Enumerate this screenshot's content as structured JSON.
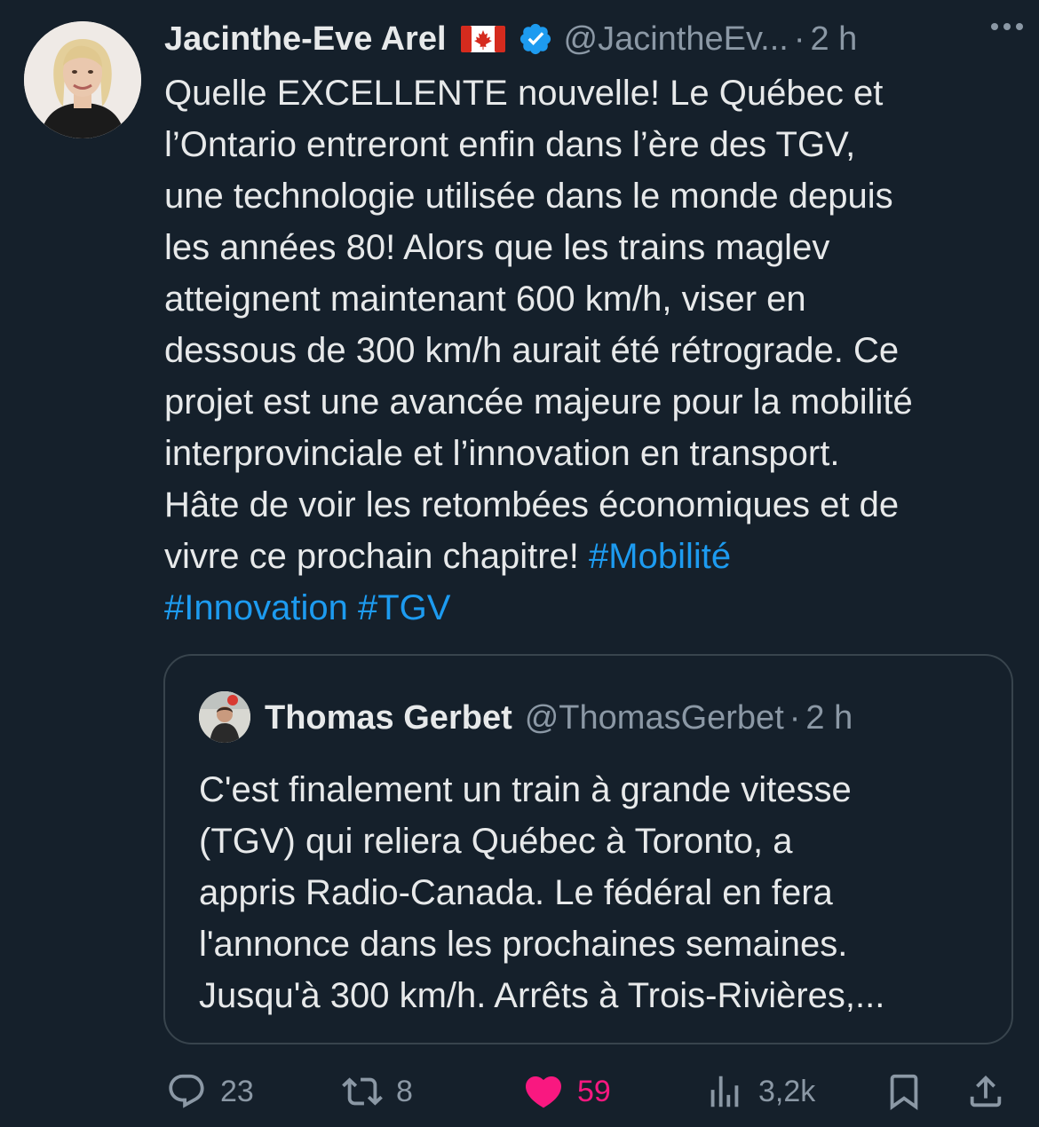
{
  "tweet": {
    "author_name": "Jacinthe-Eve Arel",
    "author_handle": "@JacintheEv...",
    "time_sep": "·",
    "time": "2 h",
    "text_lines": [
      "Quelle EXCELLENTE nouvelle! Le Québec et",
      "l’Ontario entreront enfin dans l’ère des TGV,",
      "une technologie utilisée dans le monde depuis",
      "les années 80! Alors que les trains maglev",
      "atteignent maintenant 600 km/h, viser en",
      "dessous de 300 km/h aurait été rétrograde. Ce",
      "projet est une avancée majeure pour la mobilité",
      "interprovinciale et l’innovation en transport.",
      "Hâte de voir les retombées économiques et de",
      "vivre ce prochain chapitre! "
    ],
    "hashtags": [
      "#Mobilité",
      "#Innovation",
      "#TGV"
    ]
  },
  "quoted": {
    "author_name": "Thomas Gerbet",
    "author_handle": "@ThomasGerbet",
    "time_sep": "·",
    "time": "2 h",
    "text": "C'est finalement un train à grande vitesse\n(TGV) qui reliera Québec à Toronto, a\nappris Radio-Canada. Le fédéral en fera\nl'annonce dans les prochaines semaines.\nJusqu'à 300 km/h. Arrêts à Trois-Rivières,..."
  },
  "actions": {
    "replies": "23",
    "retweets": "8",
    "likes": "59",
    "views": "3,2k"
  },
  "colors": {
    "background": "#15202b",
    "text": "#e7e9ea",
    "secondary": "#8b98a5",
    "accent": "#1d9bf0",
    "like": "#f91880",
    "border": "#38444d"
  },
  "icons": {
    "verified": "verified-badge-icon",
    "flag": "canada-flag-icon",
    "more": "more-horizontal-icon",
    "reply": "reply-icon",
    "retweet": "retweet-icon",
    "like": "heart-filled-icon",
    "views": "views-chart-icon",
    "bookmark": "bookmark-icon",
    "share": "share-icon"
  }
}
